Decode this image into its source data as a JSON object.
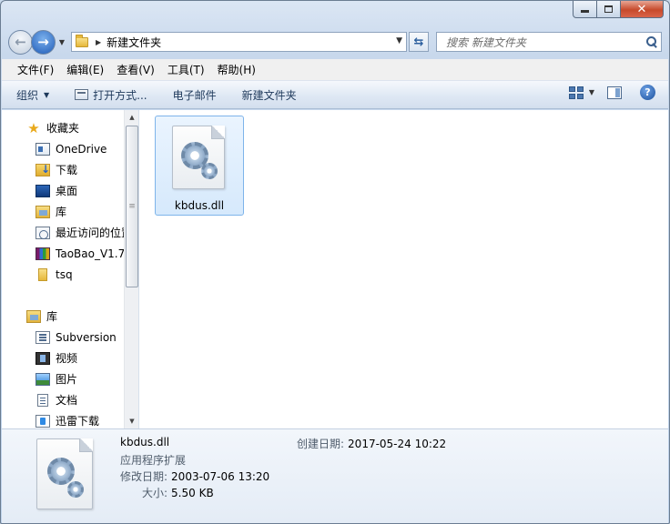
{
  "address": {
    "current_folder": "新建文件夹"
  },
  "search": {
    "placeholder": "搜索 新建文件夹"
  },
  "menu": [
    "文件(F)",
    "编辑(E)",
    "查看(V)",
    "工具(T)",
    "帮助(H)"
  ],
  "commands": {
    "organize": "组织",
    "open_with": "打开方式...",
    "email": "电子邮件",
    "new_folder": "新建文件夹"
  },
  "nav": {
    "favorites_header": "收藏夹",
    "favorites": [
      "OneDrive",
      "下载",
      "桌面",
      "库",
      "最近访问的位置",
      "TaoBao_V1.7",
      "tsq"
    ],
    "libraries_header": "库",
    "libraries": [
      "Subversion",
      "视频",
      "图片",
      "文档",
      "迅雷下载"
    ]
  },
  "files": [
    {
      "name": "kbdus.dll",
      "icon": "dll-settings-icon",
      "selected": true
    }
  ],
  "details": {
    "name": "kbdus.dll",
    "type": "应用程序扩展",
    "modified_label": "修改日期:",
    "modified_value": "2003-07-06 13:20",
    "size_label": "大小:",
    "size_value": "5.50 KB",
    "created_label": "创建日期:",
    "created_value": "2017-05-24 10:22"
  }
}
